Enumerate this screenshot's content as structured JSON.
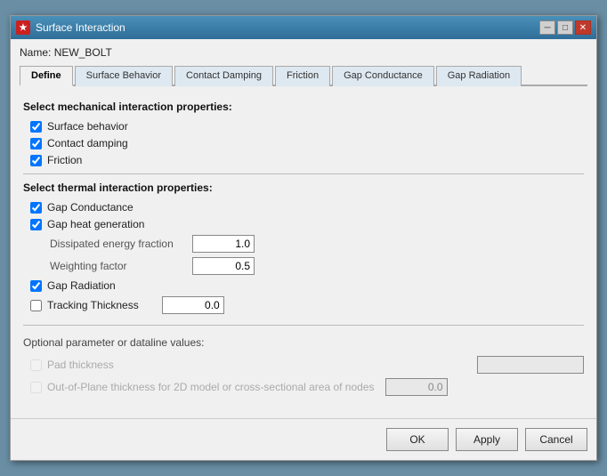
{
  "window": {
    "title": "Surface Interaction",
    "icon": "★",
    "name_label": "Name:",
    "name_value": "NEW_BOLT"
  },
  "tabs": [
    {
      "label": "Define",
      "active": true
    },
    {
      "label": "Surface Behavior",
      "active": false
    },
    {
      "label": "Contact Damping",
      "active": false
    },
    {
      "label": "Friction",
      "active": false
    },
    {
      "label": "Gap Conductance",
      "active": false
    },
    {
      "label": "Gap Radiation",
      "active": false
    }
  ],
  "sections": {
    "mechanical": {
      "title": "Select mechanical interaction properties:",
      "items": [
        {
          "label": "Surface behavior",
          "checked": true
        },
        {
          "label": "Contact damping",
          "checked": true
        },
        {
          "label": "Friction",
          "checked": true
        }
      ]
    },
    "thermal": {
      "title": "Select thermal interaction properties:",
      "items": [
        {
          "label": "Gap Conductance",
          "checked": true
        },
        {
          "label": "Gap heat generation",
          "checked": true
        }
      ],
      "inputs": [
        {
          "label": "Dissipated energy fraction",
          "value": "1.0"
        },
        {
          "label": "Weighting factor",
          "value": "0.5"
        }
      ],
      "extra_items": [
        {
          "label": "Gap Radiation",
          "checked": true
        },
        {
          "label": "Tracking Thickness",
          "checked": false
        }
      ],
      "tracking_value": "0.0"
    }
  },
  "optional": {
    "title": "Optional parameter or dataline values:",
    "items": [
      {
        "label": "Pad thickness",
        "checked": false,
        "disabled": true,
        "value": ""
      },
      {
        "label": "Out-of-Plane thickness for 2D model or cross-sectional area of nodes",
        "checked": false,
        "disabled": true,
        "value": "0.0"
      }
    ]
  },
  "buttons": {
    "ok": "OK",
    "apply": "Apply",
    "cancel": "Cancel"
  }
}
